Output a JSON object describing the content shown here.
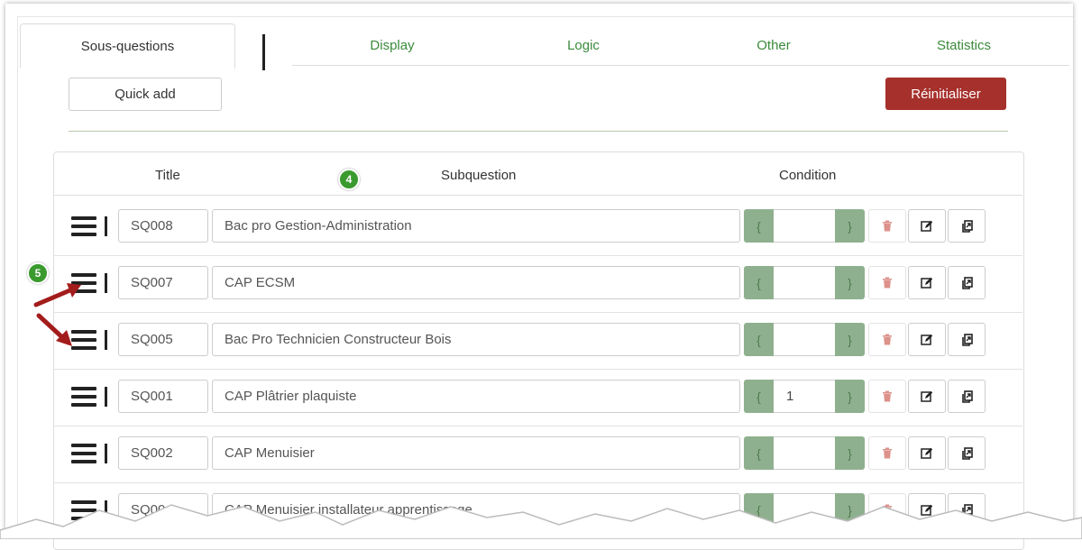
{
  "tabs": {
    "active": "Sous-questions",
    "items": [
      "Display",
      "Logic",
      "Other",
      "Statistics"
    ]
  },
  "buttons": {
    "quick_add": "Quick add",
    "reset": "Réinitialiser"
  },
  "table": {
    "headers": {
      "title": "Title",
      "subquestion": "Subquestion",
      "condition": "Condition"
    },
    "rows": [
      {
        "code": "SQ008",
        "text": "Bac pro Gestion-Administration",
        "condition": ""
      },
      {
        "code": "SQ007",
        "text": "CAP ECSM",
        "condition": ""
      },
      {
        "code": "SQ005",
        "text": "Bac Pro Technicien Constructeur Bois",
        "condition": ""
      },
      {
        "code": "SQ001",
        "text": "CAP Plâtrier plaquiste",
        "condition": "1"
      },
      {
        "code": "SQ002",
        "text": "CAP Menuisier",
        "condition": ""
      },
      {
        "code": "SQ00",
        "text": "CAP Menuisier installateur apprentissage",
        "condition": ""
      }
    ]
  },
  "badges": {
    "header_badge": "4",
    "drag_badge": "5"
  },
  "colors": {
    "tab_link": "#3b8a3b",
    "reset_button": "#a6302c",
    "condition_addon": "#8fb08f",
    "badge": "#3a9a2e",
    "arrow": "#a31c1c"
  },
  "icons": {
    "drag": "hamburger-icon",
    "delete": "trash-icon",
    "edit": "edit-icon",
    "copy": "copy-icon"
  }
}
